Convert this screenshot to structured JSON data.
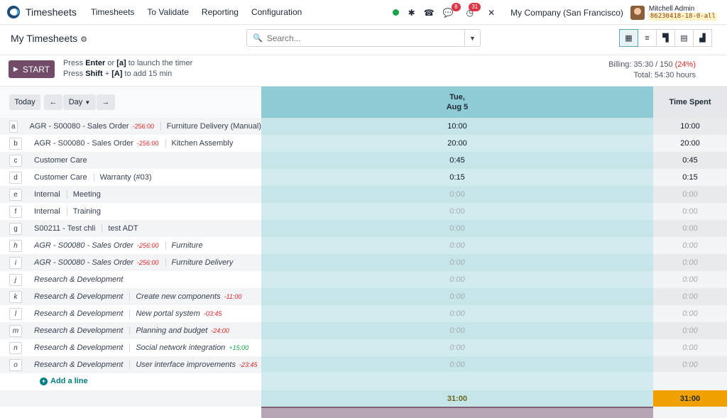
{
  "navbar": {
    "app_title": "Timesheets",
    "menu": [
      "Timesheets",
      "To Validate",
      "Reporting",
      "Configuration"
    ],
    "messages_badge": "8",
    "activities_badge": "31",
    "company": "My Company (San Francisco)",
    "user_name": "Mitchell Admin",
    "database": "86230418-18-0-all"
  },
  "control": {
    "breadcrumb": "My Timesheets",
    "search_placeholder": "Search...",
    "views": [
      "grid-icon",
      "list-icon",
      "kanban-icon",
      "pivot-icon",
      "graph-icon"
    ]
  },
  "timer": {
    "start_label": "START",
    "hint1_pre": "Press",
    "hint1_key": "Enter",
    "hint1_mid": "or",
    "hint1_key2": "[a]",
    "hint1_post": "to launch the timer",
    "hint2_pre": "Press",
    "hint2_key": "Shift",
    "hint2_plus": "+",
    "hint2_key2": "[A]",
    "hint2_post": "to add 15 min",
    "billing_label": "Billing: 35:30 / 150",
    "billing_pct": "(24%)",
    "total_label": "Total: 54:30 hours"
  },
  "grid": {
    "today_label": "Today",
    "range_label": "Day",
    "day_label_line1": "Tue,",
    "day_label_line2": "Aug 5",
    "total_header": "Time Spent",
    "add_line_label": "Add a line",
    "day_total": "31:00",
    "grand_total": "31:00",
    "rows": [
      {
        "key": "a",
        "project": "AGR - S00080 - Sales Order",
        "amount": "-256:00",
        "amount_sign": "neg",
        "task": "Furniture Delivery (Manual)",
        "value": "10:00",
        "total": "10:00",
        "italic": false,
        "active": true
      },
      {
        "key": "b",
        "project": "AGR - S00080 - Sales Order",
        "amount": "-256:00",
        "amount_sign": "neg",
        "task": "Kitchen Assembly",
        "value": "20:00",
        "total": "20:00",
        "italic": false,
        "active": true
      },
      {
        "key": "c",
        "project": "Customer Care",
        "amount": "",
        "amount_sign": "",
        "task": "",
        "value": "0:45",
        "total": "0:45",
        "italic": false,
        "active": true
      },
      {
        "key": "d",
        "project": "Customer Care",
        "amount": "",
        "amount_sign": "",
        "task": "Warranty (#03)",
        "value": "0:15",
        "total": "0:15",
        "italic": false,
        "active": true
      },
      {
        "key": "e",
        "project": "Internal",
        "amount": "",
        "amount_sign": "",
        "task": "Meeting",
        "value": "0:00",
        "total": "0:00",
        "italic": false,
        "active": false
      },
      {
        "key": "f",
        "project": "Internal",
        "amount": "",
        "amount_sign": "",
        "task": "Training",
        "value": "0:00",
        "total": "0:00",
        "italic": false,
        "active": false
      },
      {
        "key": "g",
        "project": "S00211 - Test chli",
        "amount": "",
        "amount_sign": "",
        "task": "test ADT",
        "value": "0:00",
        "total": "0:00",
        "italic": false,
        "active": false
      },
      {
        "key": "h",
        "project": "AGR - S00080 - Sales Order",
        "amount": "-256:00",
        "amount_sign": "neg",
        "task": "Furniture",
        "value": "0:00",
        "total": "0:00",
        "italic": true,
        "active": false
      },
      {
        "key": "i",
        "project": "AGR - S00080 - Sales Order",
        "amount": "-256:00",
        "amount_sign": "neg",
        "task": "Furniture Delivery",
        "value": "0:00",
        "total": "0:00",
        "italic": true,
        "active": false
      },
      {
        "key": "j",
        "project": "Research & Development",
        "amount": "",
        "amount_sign": "",
        "task": "",
        "value": "0:00",
        "total": "0:00",
        "italic": true,
        "active": false
      },
      {
        "key": "k",
        "project": "Research & Development",
        "amount": "",
        "amount_sign": "",
        "task": "Create new components",
        "task_amount": "-11:00",
        "task_amount_sign": "neg",
        "value": "0:00",
        "total": "0:00",
        "italic": true,
        "active": false
      },
      {
        "key": "l",
        "project": "Research & Development",
        "amount": "",
        "amount_sign": "",
        "task": "New portal system",
        "task_amount": "-03:45",
        "task_amount_sign": "neg",
        "value": "0:00",
        "total": "0:00",
        "italic": true,
        "active": false
      },
      {
        "key": "m",
        "project": "Research & Development",
        "amount": "",
        "amount_sign": "",
        "task": "Planning and budget",
        "task_amount": "-24:00",
        "task_amount_sign": "neg",
        "value": "0:00",
        "total": "0:00",
        "italic": true,
        "active": false
      },
      {
        "key": "n",
        "project": "Research & Development",
        "amount": "",
        "amount_sign": "",
        "task": "Social network integration",
        "task_amount": "+15:00",
        "task_amount_sign": "pos",
        "value": "0:00",
        "total": "0:00",
        "italic": true,
        "active": false
      },
      {
        "key": "o",
        "project": "Research & Development",
        "amount": "",
        "amount_sign": "",
        "task": "User interface improvements",
        "task_amount": "-23:45",
        "task_amount_sign": "neg",
        "value": "0:00",
        "total": "0:00",
        "italic": true,
        "active": false
      }
    ]
  }
}
